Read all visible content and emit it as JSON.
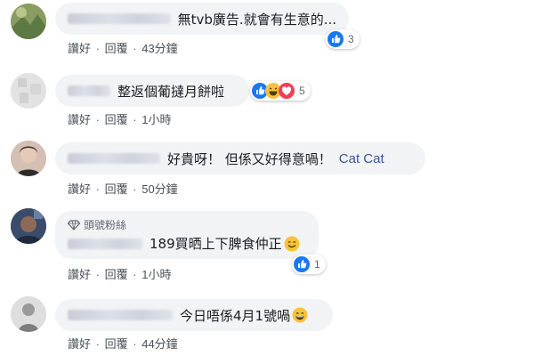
{
  "comments": [
    {
      "text": "無tvb廣告.就會有生意的...",
      "meta": {
        "like": "讚好",
        "reply": "回覆",
        "time": "43分鐘"
      },
      "reactions_count": "3"
    },
    {
      "text": "整返個葡撻月餅啦",
      "meta": {
        "like": "讚好",
        "reply": "回覆",
        "time": "1小時"
      },
      "reactions_count": "5"
    },
    {
      "text_cn": "好貴呀！ 但係又好得意喎！",
      "text_latin": "Cat Cat",
      "meta": {
        "like": "讚好",
        "reply": "回覆",
        "time": "50分鐘"
      }
    },
    {
      "badge": "頭號粉絲",
      "text": "189買晒上下脾食仲正",
      "meta": {
        "like": "讚好",
        "reply": "回覆",
        "time": "1小時"
      },
      "reactions_count": "1"
    },
    {
      "text": "今日唔係4月1號喎",
      "meta": {
        "like": "讚好",
        "reply": "回覆",
        "time": "44分鐘"
      }
    }
  ],
  "separator": "·"
}
